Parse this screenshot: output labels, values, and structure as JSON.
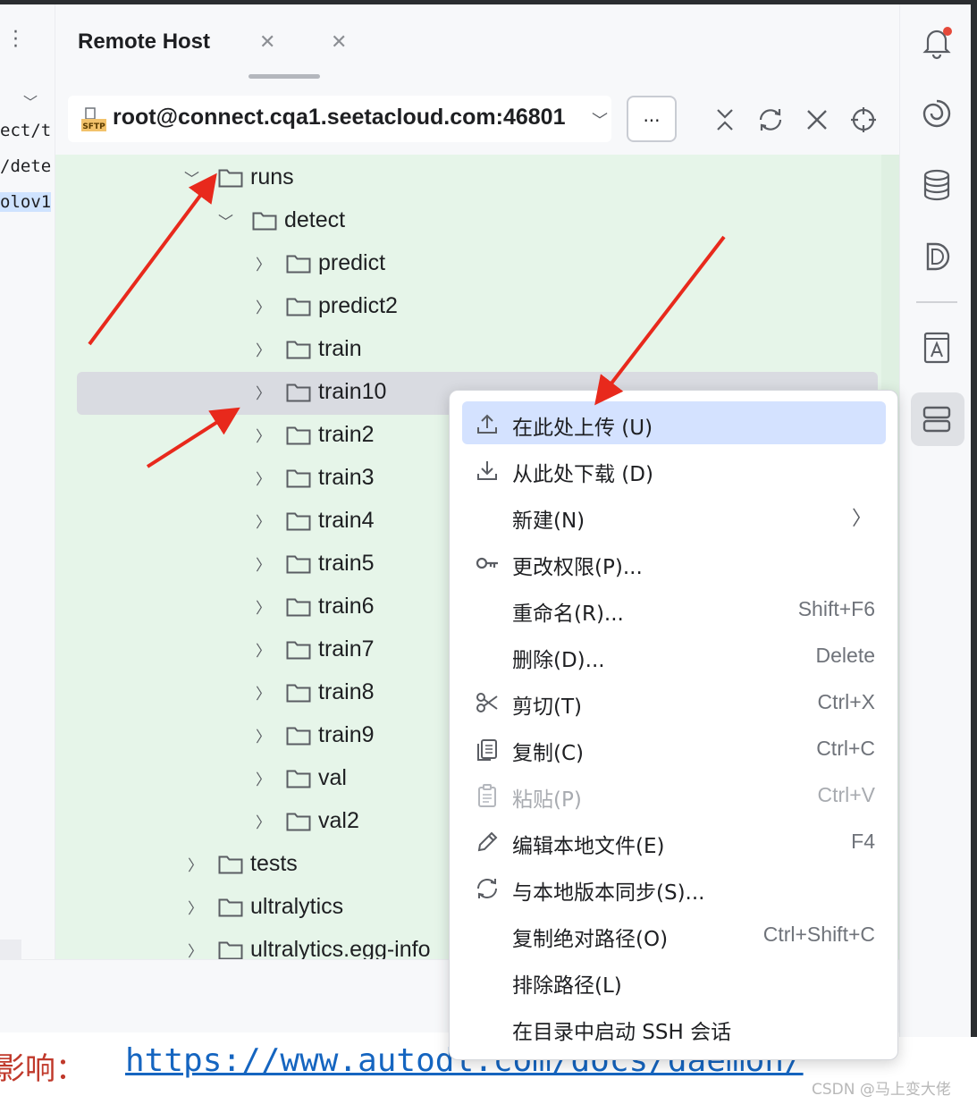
{
  "panel": {
    "tab_title": "Remote Host",
    "host": "root@connect.cqa1.seetacloud.com:46801",
    "more_label": "...",
    "sftp_badge": "SFTP"
  },
  "editor": {
    "lines": [
      "ect/t",
      "/dete",
      "olov1"
    ]
  },
  "tree": {
    "items": [
      {
        "label": "runs",
        "expanded": true
      },
      {
        "label": "detect",
        "expanded": true
      },
      {
        "label": "predict"
      },
      {
        "label": "predict2"
      },
      {
        "label": "train"
      },
      {
        "label": "train10",
        "selected": true
      },
      {
        "label": "train2"
      },
      {
        "label": "train3"
      },
      {
        "label": "train4"
      },
      {
        "label": "train5"
      },
      {
        "label": "train6"
      },
      {
        "label": "train7"
      },
      {
        "label": "train8"
      },
      {
        "label": "train9"
      },
      {
        "label": "val"
      },
      {
        "label": "val2"
      },
      {
        "label": "tests"
      },
      {
        "label": "ultralytics"
      },
      {
        "label": "ultralytics.egg-info"
      }
    ]
  },
  "menu": {
    "items": [
      {
        "label": "在此处上传 (U)",
        "shortcut": "",
        "icon": "upload-icon"
      },
      {
        "label": "从此处下载 (D)",
        "shortcut": "",
        "icon": "download-icon"
      },
      {
        "label": "新建(N)",
        "shortcut": "",
        "icon": ""
      },
      {
        "label": "更改权限(P)...",
        "shortcut": "",
        "icon": "key-icon"
      },
      {
        "label": "重命名(R)...",
        "shortcut": "Shift+F6",
        "icon": ""
      },
      {
        "label": "删除(D)...",
        "shortcut": "Delete",
        "icon": ""
      },
      {
        "label": "剪切(T)",
        "shortcut": "Ctrl+X",
        "icon": "scissors-icon"
      },
      {
        "label": "复制(C)",
        "shortcut": "Ctrl+C",
        "icon": "copy-icon"
      },
      {
        "label": "粘贴(P)",
        "shortcut": "Ctrl+V",
        "icon": "paste-icon",
        "disabled": true
      },
      {
        "label": "编辑本地文件(E)",
        "shortcut": "F4",
        "icon": "pencil-icon"
      },
      {
        "label": "与本地版本同步(S)...",
        "shortcut": "",
        "icon": "sync-icon"
      },
      {
        "label": "复制绝对路径(O)",
        "shortcut": "Ctrl+Shift+C",
        "icon": ""
      },
      {
        "label": "排除路径(L)",
        "shortcut": "",
        "icon": ""
      },
      {
        "label": "在目录中启动 SSH 会话",
        "shortcut": "",
        "icon": ""
      }
    ]
  },
  "footer": {
    "prefix": "影响：",
    "url": "https://www.autodl.com/docs/daemon/",
    "watermark": "CSDN @马上变大佬"
  },
  "colors": {
    "tree_bg": "#e6f5e9",
    "menu_selected": "#d4e2ff",
    "arrow": "#e8291c",
    "link": "#1565c0"
  }
}
